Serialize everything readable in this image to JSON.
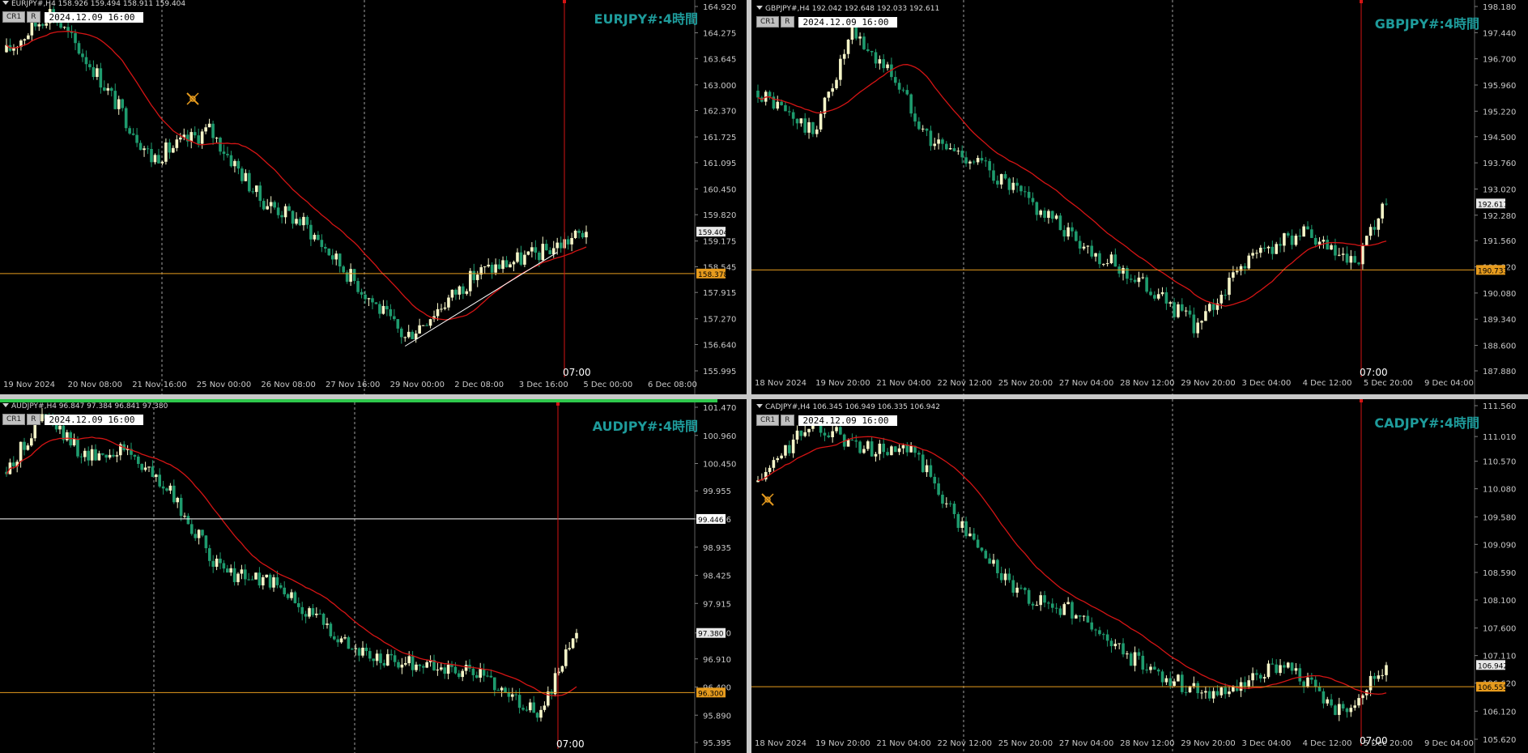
{
  "colors": {
    "bg": "#000000",
    "bull": "#f5f5c8",
    "bear": "#1e9b6e",
    "ma": "#d41414",
    "hline_orange": "#e69b1e",
    "hline_white": "#ffffff",
    "vline_red": "#d41414",
    "grid_dash": "#a0a0a0",
    "axis_text": "#c8c8c8",
    "title": "#1e9b9b"
  },
  "panels": [
    {
      "id": "eurjpy",
      "header": "EURJPY#,H4  158.926 159.494 158.911 159.404",
      "badge1": "CR1",
      "badge2": "R",
      "datetime": "2024.12.09  16:00",
      "title": "EURJPY#:4時間",
      "price_ticks": [
        "164.920",
        "164.275",
        "163.645",
        "163.000",
        "162.370",
        "161.725",
        "161.095",
        "160.450",
        "159.820",
        "159.175",
        "158.545",
        "157.915",
        "157.270",
        "156.640",
        "155.995"
      ],
      "y_max": 164.92,
      "y_min": 155.995,
      "time_ticks": [
        "19 Nov 2024",
        "20 Nov 08:00",
        "21 Nov 16:00",
        "25 Nov 00:00",
        "26 Nov 08:00",
        "27 Nov 16:00",
        "29 Nov 00:00",
        "2 Dec 08:00",
        "3 Dec 16:00",
        "5 Dec 00:00",
        "6 Dec 08:00"
      ],
      "time_label": "07:00",
      "current_price": "159.404",
      "hline_price": "158.378",
      "hline_value": 158.378,
      "hline_color": "orange",
      "start": 163.8,
      "end": 159.4,
      "pivots": [
        [
          0,
          163.8
        ],
        [
          12,
          164.8
        ],
        [
          24,
          163.4
        ],
        [
          40,
          161.2
        ],
        [
          56,
          161.9
        ],
        [
          70,
          160.2
        ],
        [
          82,
          159.6
        ],
        [
          95,
          158.3
        ],
        [
          110,
          156.8
        ],
        [
          130,
          158.4
        ],
        [
          148,
          158.9
        ],
        [
          160,
          159.4
        ]
      ],
      "cross_marker": true,
      "trendline": true
    },
    {
      "id": "gbpjpy",
      "header": "GBPJPY#,H4  192.042 192.648 192.033 192.611",
      "badge1": "CR1",
      "badge2": "R",
      "datetime": "2024.12.09  16:00",
      "title": "GBPJPY#:4時間",
      "price_ticks": [
        "198.180",
        "197.440",
        "196.700",
        "195.960",
        "195.220",
        "194.500",
        "193.760",
        "193.020",
        "192.280",
        "191.560",
        "190.820",
        "190.080",
        "189.340",
        "188.600",
        "187.880"
      ],
      "y_max": 198.18,
      "y_min": 187.88,
      "time_ticks": [
        "18 Nov 2024",
        "19 Nov 20:00",
        "21 Nov 04:00",
        "22 Nov 12:00",
        "25 Nov 20:00",
        "27 Nov 04:00",
        "28 Nov 12:00",
        "29 Nov 20:00",
        "3 Dec 04:00",
        "4 Dec 12:00",
        "5 Dec 20:00",
        "9 Dec 04:00"
      ],
      "time_label": "07:00",
      "current_price": "192.611",
      "hline_price": "190.733",
      "hline_value": 190.733,
      "hline_color": "orange",
      "start": 195.8,
      "end": 192.6,
      "pivots": [
        [
          0,
          195.8
        ],
        [
          14,
          194.6
        ],
        [
          24,
          197.4
        ],
        [
          34,
          196.3
        ],
        [
          44,
          194.4
        ],
        [
          56,
          193.8
        ],
        [
          72,
          192.4
        ],
        [
          86,
          191.2
        ],
        [
          100,
          190.2
        ],
        [
          112,
          189.1
        ],
        [
          124,
          191.0
        ],
        [
          138,
          191.8
        ],
        [
          152,
          190.8
        ],
        [
          160,
          192.6
        ]
      ],
      "cross_marker": false,
      "trendline": false
    },
    {
      "id": "audjpy",
      "header": "AUDJPY#,H4  96.847 97.384 96.841 97.380",
      "badge1": "CR1",
      "badge2": "R",
      "datetime": "2024.12.09  16:00",
      "title": "AUDJPY#:4時間",
      "price_ticks": [
        "101.470",
        "100.960",
        "100.450",
        "99.955",
        "99.446",
        "98.935",
        "98.425",
        "97.915",
        "97.380",
        "96.910",
        "96.400",
        "95.890",
        "95.395"
      ],
      "y_max": 101.47,
      "y_min": 95.395,
      "time_ticks": [],
      "time_label": "07:00",
      "current_price": "97.380",
      "hline_price": "96.300",
      "hline_value": 96.3,
      "hline_color": "orange",
      "white_hline_price": "99.446",
      "white_hline_value": 99.446,
      "start": 100.3,
      "end": 97.38,
      "pivots": [
        [
          0,
          100.3
        ],
        [
          10,
          101.3
        ],
        [
          22,
          100.6
        ],
        [
          34,
          100.7
        ],
        [
          46,
          99.9
        ],
        [
          60,
          98.5
        ],
        [
          74,
          98.3
        ],
        [
          88,
          97.6
        ],
        [
          102,
          96.9
        ],
        [
          118,
          96.8
        ],
        [
          134,
          96.6
        ],
        [
          150,
          95.9
        ],
        [
          160,
          97.4
        ]
      ],
      "cross_marker": false,
      "trendline": false
    },
    {
      "id": "cadjpy",
      "header": "CADJPY#,H4  106.345 106.949 106.335 106.942",
      "badge1": "CR1",
      "badge2": "R",
      "datetime": "2024.12.09  16:00",
      "title": "CADJPY#:4時間",
      "price_ticks": [
        "111.560",
        "111.010",
        "110.570",
        "110.080",
        "109.580",
        "109.090",
        "108.590",
        "108.100",
        "107.600",
        "107.110",
        "106.620",
        "106.120",
        "105.620"
      ],
      "y_max": 111.56,
      "y_min": 105.62,
      "time_ticks": [
        "18 Nov 2024",
        "19 Nov 20:00",
        "21 Nov 04:00",
        "22 Nov 12:00",
        "25 Nov 20:00",
        "27 Nov 04:00",
        "28 Nov 12:00",
        "29 Nov 20:00",
        "3 Dec 04:00",
        "4 Dec 12:00",
        "5 Dec 20:00",
        "9 Dec 04:00"
      ],
      "time_label": "07:00",
      "current_price": "106.942",
      "hline_price": "106.555",
      "hline_value": 106.555,
      "hline_color": "orange",
      "start": 110.2,
      "end": 106.94,
      "pivots": [
        [
          0,
          110.2
        ],
        [
          14,
          111.3
        ],
        [
          26,
          110.8
        ],
        [
          40,
          110.7
        ],
        [
          52,
          109.4
        ],
        [
          66,
          108.2
        ],
        [
          80,
          107.9
        ],
        [
          94,
          107.1
        ],
        [
          108,
          106.6
        ],
        [
          120,
          106.4
        ],
        [
          134,
          107.0
        ],
        [
          148,
          106.1
        ],
        [
          160,
          106.9
        ]
      ],
      "cross_marker": true,
      "trendline": false
    }
  ]
}
